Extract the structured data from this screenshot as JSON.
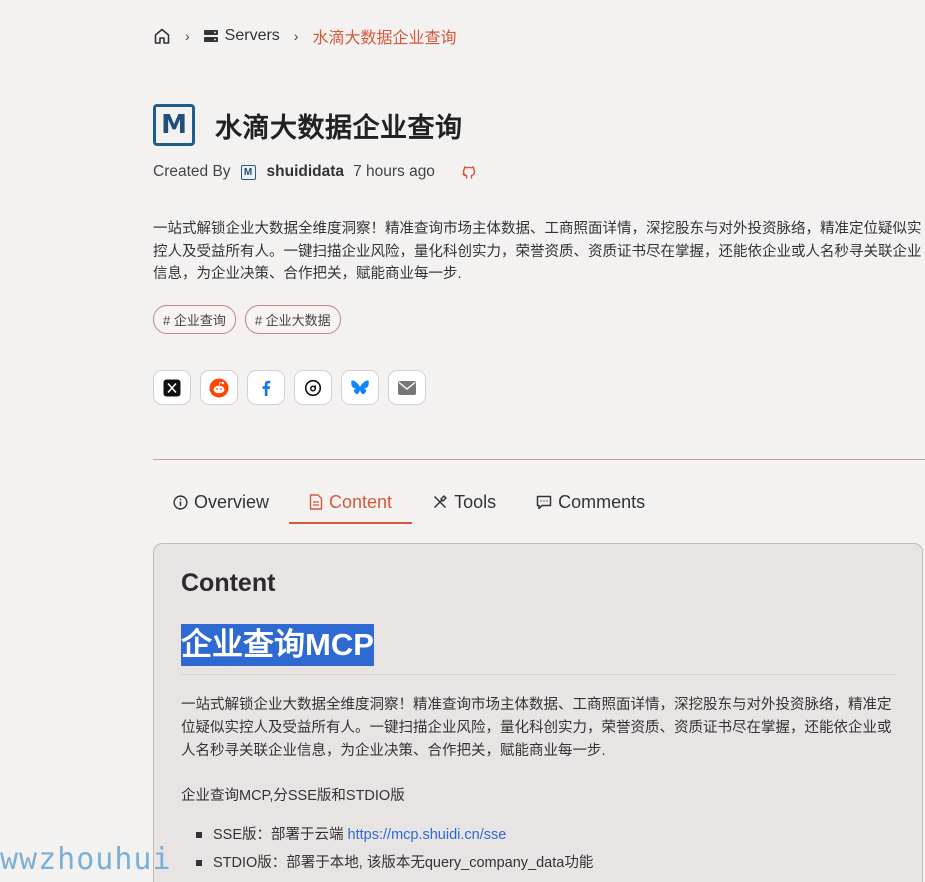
{
  "breadcrumb": {
    "home_icon": "home-icon",
    "servers_label": "Servers",
    "current": "水滴大数据企业查询"
  },
  "server": {
    "title": "水滴大数据企业查询",
    "logo_letter": "M",
    "created_by_label": "Created By",
    "author": "shuididata",
    "time": "7 hours ago",
    "description": "一站式解锁企业大数据全维度洞察！精准查询市场主体数据、工商照面详情，深挖股东与对外投资脉络，精准定位疑似实控人及受益所有人。一键扫描企业风险，量化科创实力，荣誉资质、资质证书尽在掌握，还能依企业或人名秒寻关联企业信息，为企业决策、合作把关，赋能商业每一步.",
    "tags": [
      "# 企业查询",
      "# 企业大数据"
    ]
  },
  "share": [
    "x-icon",
    "reddit-icon",
    "facebook-icon",
    "threads-icon",
    "bluesky-icon",
    "mail-icon"
  ],
  "tabs": [
    {
      "label": "Overview",
      "icon": "info-icon"
    },
    {
      "label": "Content",
      "icon": "document-icon",
      "active": true
    },
    {
      "label": "Tools",
      "icon": "tools-icon"
    },
    {
      "label": "Comments",
      "icon": "comment-icon"
    }
  ],
  "content": {
    "heading": "Content",
    "h1": "企业查询MCP",
    "p1": "一站式解锁企业大数据全维度洞察！精准查询市场主体数据、工商照面详情，深挖股东与对外投资脉络，精准定位疑似实控人及受益所有人。一键扫描企业风险，量化科创实力，荣誉资质、资质证书尽在掌握，还能依企业或人名秒寻关联企业信息，为企业决策、合作把关，赋能商业每一步.",
    "p2": "企业查询MCP,分SSE版和STDIO版",
    "list": [
      {
        "text": "SSE版：部署于云端 ",
        "link": "https://mcp.shuidi.cn/sse"
      },
      {
        "text": "STDIO版：部署于本地, 该版本无query_company_data功能",
        "link": ""
      }
    ]
  },
  "watermark": "wwzhouhui",
  "colors": {
    "accent": "#d4593a",
    "link": "#2f6ad3",
    "selection": "#2f6ad3",
    "background": "#f4f2f1"
  }
}
